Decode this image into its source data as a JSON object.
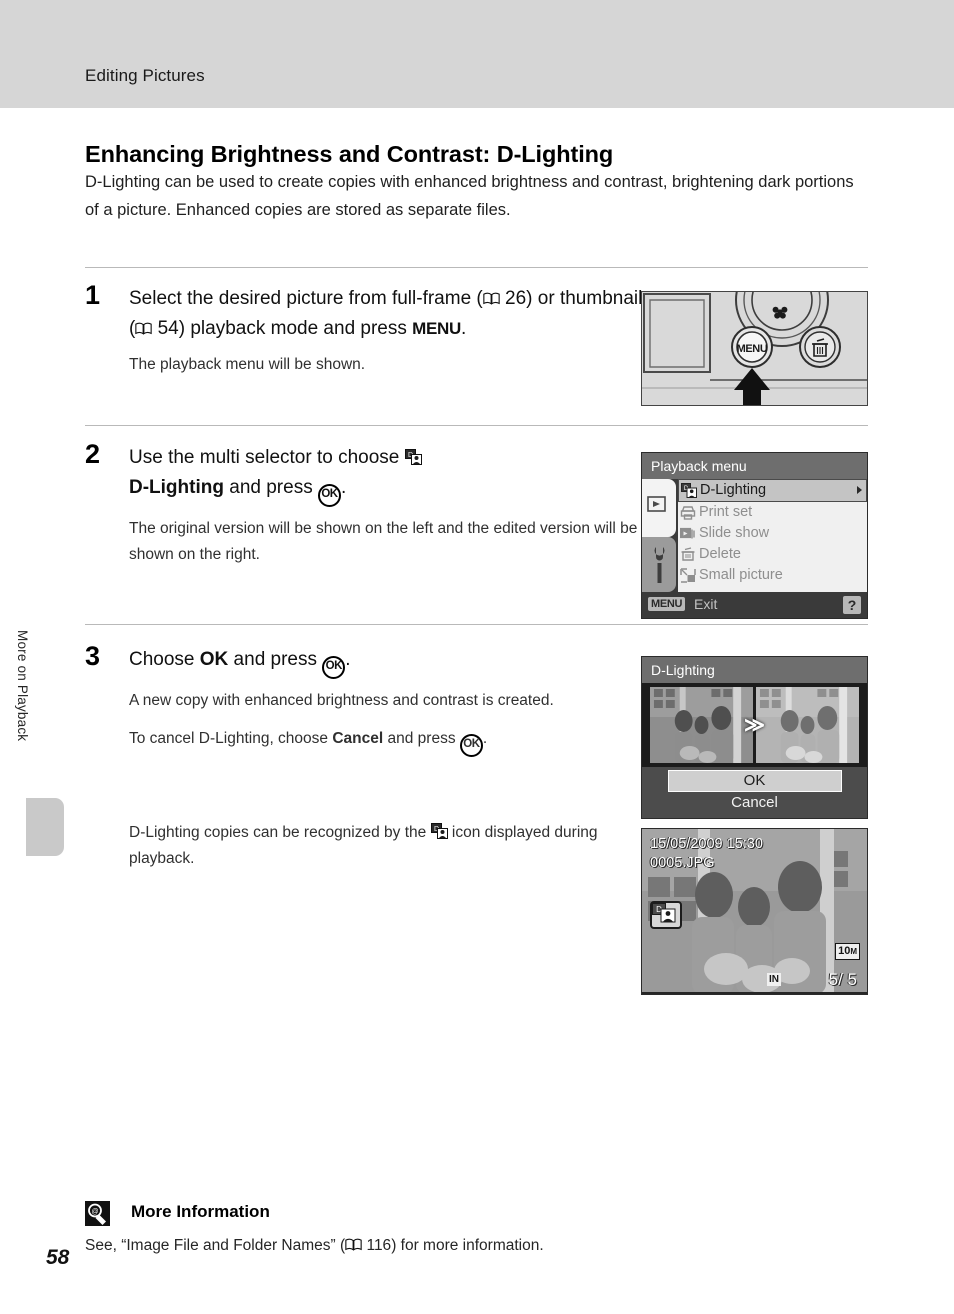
{
  "header": {
    "running_title": "Editing Pictures"
  },
  "side_tab": {
    "label": "More on Playback"
  },
  "page": {
    "title": "Enhancing Brightness and Contrast: D-Lighting",
    "intro": "D-Lighting can be used to create copies with enhanced brightness and contrast, brightening dark portions of a picture. Enhanced copies are stored as separate files.",
    "number": "58"
  },
  "steps": [
    {
      "number": "1",
      "head_part1": "Select the desired picture from full-frame (",
      "ref1": "26",
      "head_part2": ") or thumbnail (",
      "ref2": "54",
      "head_part3": ") playback mode and press ",
      "menu_key": "MENU",
      "head_end": ".",
      "sub": "The playback menu will be shown."
    },
    {
      "number": "2",
      "head_part1": "Use the multi selector to choose ",
      "bold": "D-Lighting",
      "head_part2": " and press ",
      "ok_key": "OK",
      "head_end": ".",
      "sub": "The original version will be shown on the left and the edited version will be shown on the right."
    },
    {
      "number": "3",
      "head_part1": "Choose ",
      "bold": "OK",
      "head_part2": " and press ",
      "ok_key": "OK",
      "head_end": ".",
      "sub1": "A new copy with enhanced brightness and contrast is created.",
      "sub2_pre": "To cancel D-Lighting, choose ",
      "sub2_bold": "Cancel",
      "sub2_post": " and press ",
      "sub2_end": "."
    }
  ],
  "note": {
    "pre": "D-Lighting copies can be recognized by the ",
    "post": " icon displayed during playback."
  },
  "camera_figure": {
    "menu_button_label": "MENU"
  },
  "playback_menu": {
    "title": "Playback menu",
    "items": [
      {
        "label": "D-Lighting",
        "icon": "d-lighting-icon",
        "selected": true,
        "submenu_arrow": true
      },
      {
        "label": "Print set",
        "icon": "print-set-icon",
        "selected": false
      },
      {
        "label": "Slide show",
        "icon": "slide-show-icon",
        "selected": false
      },
      {
        "label": "Delete",
        "icon": "delete-icon",
        "selected": false
      },
      {
        "label": "Small picture",
        "icon": "small-picture-icon",
        "selected": false
      }
    ],
    "footer": {
      "menu_key": "MENU",
      "exit_label": "Exit",
      "help_label": "?"
    }
  },
  "dlighting_screen": {
    "title": "D-Lighting",
    "arrow": "≫",
    "ok_label": "OK",
    "cancel_label": "Cancel"
  },
  "playback_screen": {
    "date": "15/05/2009 15:30",
    "filename": "0005.JPG",
    "quality": "10",
    "quality_unit": "M",
    "memory": "IN",
    "frame_counter": "5/    5"
  },
  "more_information": {
    "heading": "More Information",
    "body": "See, “Image File and Folder Names” (",
    "ref_page": "116",
    "body_end": ") for more information."
  },
  "colors": {
    "header_band": "#d6d6d6",
    "rule": "#b9b9b9",
    "lcd_dark": "#3a3a3a",
    "lcd_title": "#6e6e6e",
    "menu_list_bg": "#f0f0f0",
    "selection": "#c4c4c4"
  }
}
